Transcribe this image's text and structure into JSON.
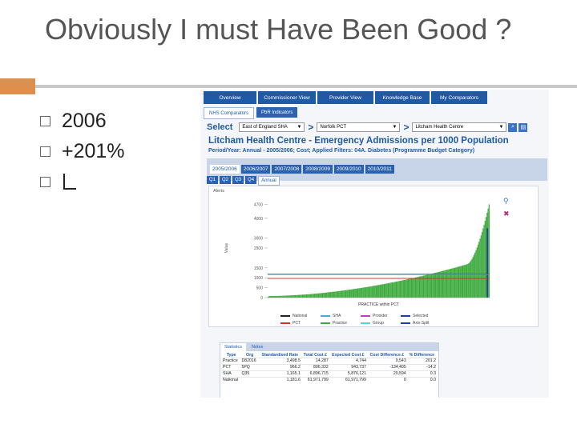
{
  "slide": {
    "title": "Obviously I must Have Been Good ?",
    "bullets": [
      "2006",
      "+201%",
      ""
    ]
  },
  "app": {
    "nav_tabs": [
      "Overview",
      "Commissioner View",
      "Provider View",
      "Knowledge Base",
      "My Comparators"
    ],
    "sub_tabs": [
      "NHS Comparators",
      "PbR Indicators"
    ],
    "select": {
      "label": "Select",
      "sha": "East of England SHA",
      "pct": "Norfolk PCT",
      "practice": "Litcham Health Centre"
    },
    "chart_title": "Litcham Health Centre - Emergency Admissions per 1000 Population",
    "chart_subtitle": "Period/Year: Annual - 2005/2006; Cost; Applied Filters: 04A. Diabetes (Programme Budget Category)",
    "year_tabs": [
      "2005/2006",
      "2006/2007",
      "2007/2008",
      "2008/2009",
      "2009/2010",
      "2010/2011"
    ],
    "quarter_tabs": [
      "Q1",
      "Q2",
      "Q3",
      "Q4",
      "Annual"
    ],
    "alerts_label": "Alerts",
    "stats_tabs": [
      "Statistics",
      "Notes"
    ],
    "stats_headers": [
      "Type",
      "Org",
      "Standardised Rate",
      "Total Cost £",
      "Expected Cost £",
      "Cost Difference £",
      "% Difference"
    ],
    "stats_rows": [
      [
        "Practice",
        "D82016",
        "3,498.5",
        "14,287",
        "4,744",
        "9,543",
        "201.2"
      ],
      [
        "PCT",
        "5PQ",
        "966.2",
        "806,332",
        "943,737",
        "-134,405",
        "-14.2"
      ],
      [
        "SHA",
        "Q35",
        "1,165.1",
        "6,896,715",
        "5,876,121",
        "20,594",
        "0.3"
      ],
      [
        "National",
        "",
        "1,181.6",
        "61,971,799",
        "61,971,799",
        "0",
        "0.0"
      ]
    ]
  },
  "chart_data": {
    "type": "bar",
    "ylabel": "Value",
    "xlabel": "PRACTICE within PCT",
    "ylim": [
      0,
      5000
    ],
    "yticks": [
      0,
      500,
      1000,
      1500,
      2500,
      3000,
      4000,
      4700
    ],
    "n_practices": 220,
    "start_value": 0,
    "end_value": 4700,
    "selected_value": 3498.5,
    "reference_lines": [
      {
        "name": "National",
        "value": 1181.6,
        "color": "#222222"
      },
      {
        "name": "PCT",
        "value": 966.2,
        "color": "#d9302b"
      },
      {
        "name": "SHA",
        "value": 1165.1,
        "color": "#4aa8d8"
      }
    ],
    "legend": [
      {
        "name": "National",
        "color": "#222222"
      },
      {
        "name": "SHA",
        "color": "#4aa8d8"
      },
      {
        "name": "Provider",
        "color": "#c040c0"
      },
      {
        "name": "Selected",
        "color": "#1f3f9a"
      },
      {
        "name": "PCT",
        "color": "#d9302b"
      },
      {
        "name": "Practice",
        "color": "#3daa3d"
      },
      {
        "name": "Group",
        "color": "#60d0e0"
      },
      {
        "name": "Axis Split",
        "color": "#1f3f9a"
      }
    ],
    "colors": {
      "bar": "#3daa3d",
      "selected": "#1f3f9a"
    }
  }
}
